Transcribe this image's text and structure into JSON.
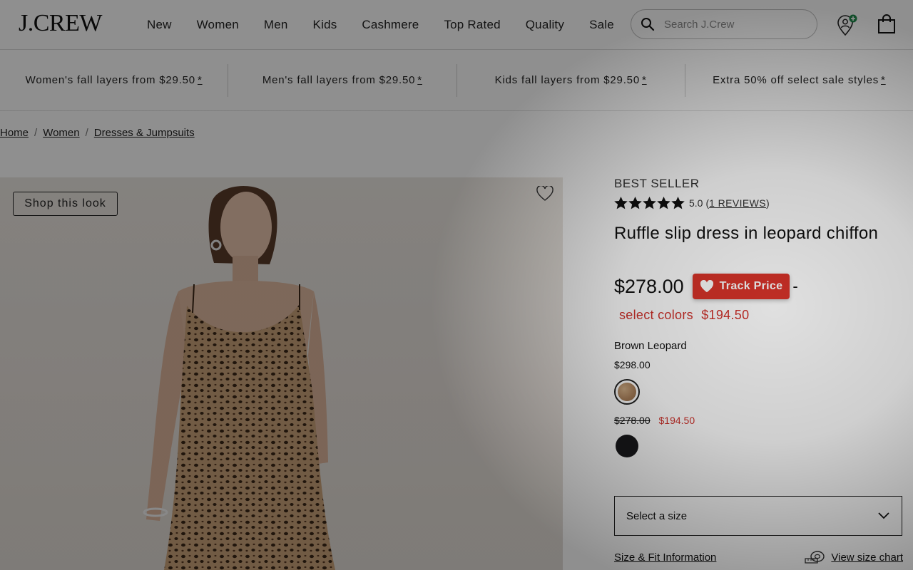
{
  "header": {
    "logo": "J.CREW",
    "nav": [
      "New",
      "Women",
      "Men",
      "Kids",
      "Cashmere",
      "Top Rated",
      "Quality",
      "Sale"
    ],
    "search_placeholder": "Search J.Crew",
    "icons": [
      "search-icon",
      "account-location-icon",
      "shopping-bag-icon"
    ]
  },
  "promo": {
    "items": [
      {
        "text": "Women's fall layers from $29.50",
        "marker": "*"
      },
      {
        "text": "Men's fall layers from $29.50",
        "marker": "*"
      },
      {
        "text": "Kids fall layers from $29.50",
        "marker": "*"
      },
      {
        "text": "Extra 50% off select sale styles",
        "marker": "*"
      }
    ]
  },
  "breadcrumb": {
    "items": [
      "Home",
      "Women",
      "Dresses & Jumpsuits"
    ],
    "separator": "/"
  },
  "image": {
    "shop_look_label": "Shop this look"
  },
  "product": {
    "badge": "BEST SELLER",
    "rating_value": "5.0",
    "reviews_label": "1 REVIEWS",
    "reviews_open": "(",
    "reviews_close": ")",
    "title": "Ruffle slip dress in leopard chiffon",
    "price": "$278.00",
    "track_price_label": "Track Price",
    "price_dash": "-",
    "sale_prefix": "select colors",
    "sale_price": "$194.50",
    "color_name": "Brown Leopard",
    "color_price": "$298.00",
    "was_price": "$278.00",
    "now_price": "$194.50",
    "size_placeholder": "Select a size",
    "size_fit_label": "Size & Fit Information",
    "size_chart_label": "View size chart",
    "stars": 5
  },
  "colors": {
    "accent_red": "#d9342a",
    "sale_red": "#d0302a"
  }
}
